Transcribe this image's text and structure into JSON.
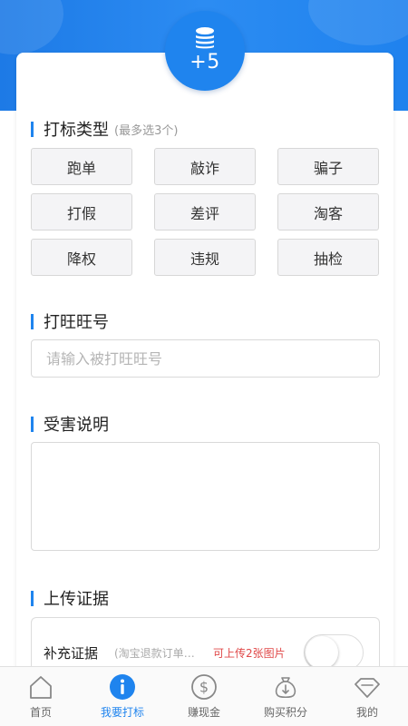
{
  "header": {
    "points_badge": "+5",
    "coin_icon": "coins-stack-icon",
    "colors": {
      "primary": "#1f84ee",
      "danger": "#e04848"
    }
  },
  "tag_type": {
    "title": "打标类型",
    "hint": "(最多选3个)",
    "options": [
      "跑单",
      "敲诈",
      "骗子",
      "打假",
      "差评",
      "淘客",
      "降权",
      "违规",
      "抽检"
    ]
  },
  "wangwang": {
    "title": "打旺旺号",
    "placeholder": "请输入被打旺旺号",
    "value": ""
  },
  "damage": {
    "title": "受害说明",
    "value": ""
  },
  "evidence": {
    "title": "上传证据",
    "label": "补充证据",
    "note": "(淘宝退款订单截...",
    "limit": "可上传2张图片",
    "toggle_on": false
  },
  "tabbar": {
    "items": [
      {
        "label": "首页",
        "icon": "home-icon",
        "active": false
      },
      {
        "label": "我要打标",
        "icon": "info-icon",
        "active": true
      },
      {
        "label": "赚现金",
        "icon": "dollar-coin-icon",
        "active": false
      },
      {
        "label": "购买积分",
        "icon": "money-bag-icon",
        "active": false
      },
      {
        "label": "我的",
        "icon": "diamond-icon",
        "active": false
      }
    ]
  }
}
